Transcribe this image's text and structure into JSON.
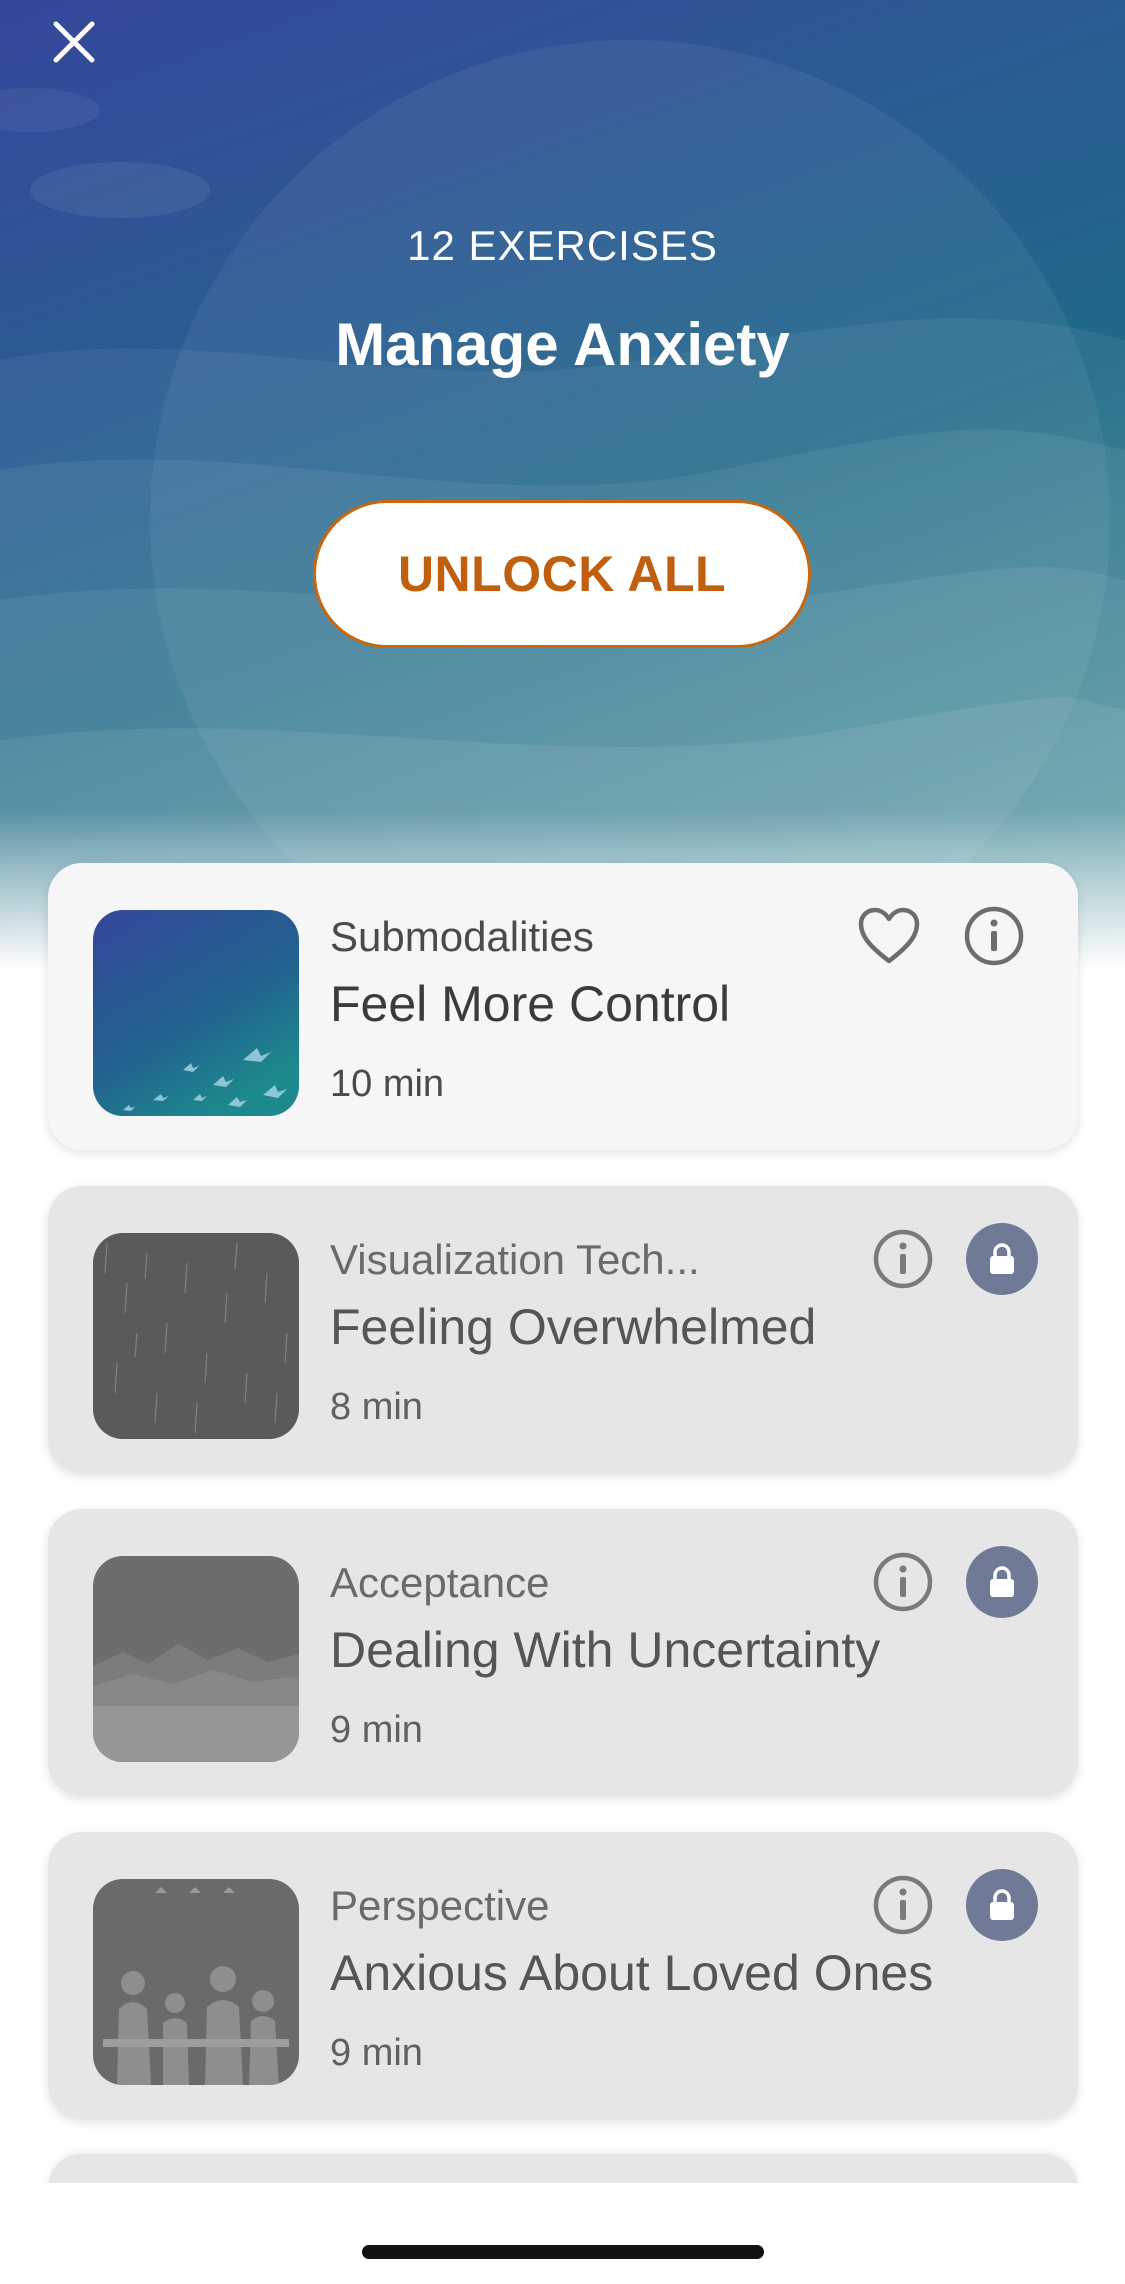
{
  "header": {
    "exercise_count": "12 EXERCISES",
    "title": "Manage Anxiety",
    "unlock_label": "UNLOCK ALL"
  },
  "icons": {
    "close": "close-icon",
    "favorite": "heart-icon",
    "info": "info-icon",
    "lock": "lock-icon"
  },
  "colors": {
    "accent": "#c0600f",
    "lock_badge": "#6f7a96",
    "hero_start": "#34479a",
    "hero_end": "#5a9ca4"
  },
  "exercises": [
    {
      "category": "Submodalities",
      "title": "Feel More Control",
      "duration": "10 min",
      "locked": false
    },
    {
      "category": "Visualization Tech...",
      "title": "Feeling Overwhelmed",
      "duration": "8 min",
      "locked": true
    },
    {
      "category": "Acceptance",
      "title": "Dealing With Uncertainty",
      "duration": "9 min",
      "locked": true
    },
    {
      "category": "Perspective",
      "title": "Anxious About Loved Ones",
      "duration": "9 min",
      "locked": true
    }
  ]
}
